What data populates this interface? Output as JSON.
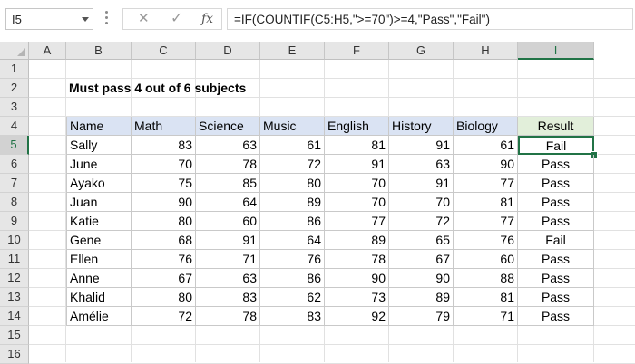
{
  "formula_bar": {
    "name_box": "I5",
    "cancel_icon": "✕",
    "enter_icon": "✓",
    "fx_label": "fx",
    "formula": "=IF(COUNTIF(C5:H5,\">=70\")>=4,\"Pass\",\"Fail\")"
  },
  "columns": [
    "A",
    "B",
    "C",
    "D",
    "E",
    "F",
    "G",
    "H",
    "I"
  ],
  "rows": [
    "1",
    "2",
    "3",
    "4",
    "5",
    "6",
    "7",
    "8",
    "9",
    "10",
    "11",
    "12",
    "13",
    "14",
    "15",
    "16"
  ],
  "sheet": {
    "title": "Must pass 4 out of 6 subjects",
    "headers": [
      "Name",
      "Math",
      "Science",
      "Music",
      "English",
      "History",
      "Biology",
      "Result"
    ],
    "students": [
      {
        "name": "Sally",
        "scores": [
          "83",
          "63",
          "61",
          "81",
          "91",
          "61"
        ],
        "result": "Fail"
      },
      {
        "name": "June",
        "scores": [
          "70",
          "78",
          "72",
          "91",
          "63",
          "90"
        ],
        "result": "Pass"
      },
      {
        "name": "Ayako",
        "scores": [
          "75",
          "85",
          "80",
          "70",
          "91",
          "77"
        ],
        "result": "Pass"
      },
      {
        "name": "Juan",
        "scores": [
          "90",
          "64",
          "89",
          "70",
          "70",
          "81"
        ],
        "result": "Pass"
      },
      {
        "name": "Katie",
        "scores": [
          "80",
          "60",
          "86",
          "77",
          "72",
          "77"
        ],
        "result": "Pass"
      },
      {
        "name": "Gene",
        "scores": [
          "68",
          "91",
          "64",
          "89",
          "65",
          "76"
        ],
        "result": "Fail"
      },
      {
        "name": "Ellen",
        "scores": [
          "76",
          "71",
          "76",
          "78",
          "67",
          "60"
        ],
        "result": "Pass"
      },
      {
        "name": "Anne",
        "scores": [
          "67",
          "63",
          "86",
          "90",
          "90",
          "88"
        ],
        "result": "Pass"
      },
      {
        "name": "Khalid",
        "scores": [
          "80",
          "83",
          "62",
          "73",
          "89",
          "81"
        ],
        "result": "Pass"
      },
      {
        "name": "Amélie",
        "scores": [
          "72",
          "78",
          "83",
          "92",
          "79",
          "71"
        ],
        "result": "Pass"
      }
    ]
  },
  "selection": {
    "column": "I",
    "row": "5"
  },
  "colors": {
    "accent": "#217346",
    "header_blue": "#dae3f3",
    "header_green": "#e2efda"
  }
}
